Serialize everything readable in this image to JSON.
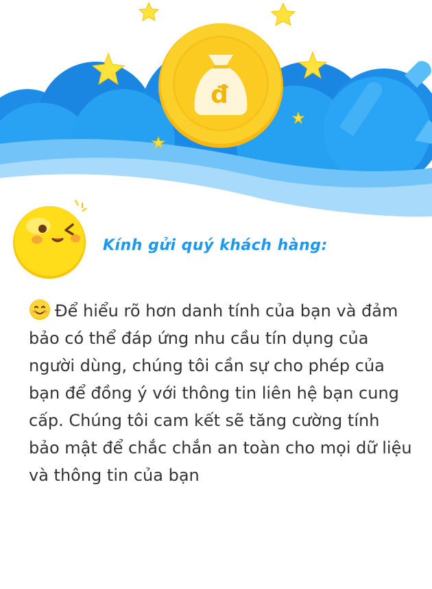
{
  "hero": {
    "coin_symbol": "đ",
    "sky_color": "#1e98ee",
    "coin_color": "#fcd02a",
    "star_color": "#ffe23b"
  },
  "greeting": {
    "text": "Kính gửi quý khách hàng:",
    "color": "#1e98ee"
  },
  "message": {
    "icon": "smiling-face-emoji",
    "text": "Để hiểu rõ hơn danh tính của bạn và đảm bảo có thể đáp ứng nhu cầu tín dụng của người dùng, chúng tôi cần sự cho phép của bạn để đồng ý với thông tin liên hệ bạn cung cấp. Chúng tôi cam kết sẽ tăng cường tính bảo mật để chắc chắn an toàn cho mọi dữ liệu và thông tin của bạn"
  }
}
